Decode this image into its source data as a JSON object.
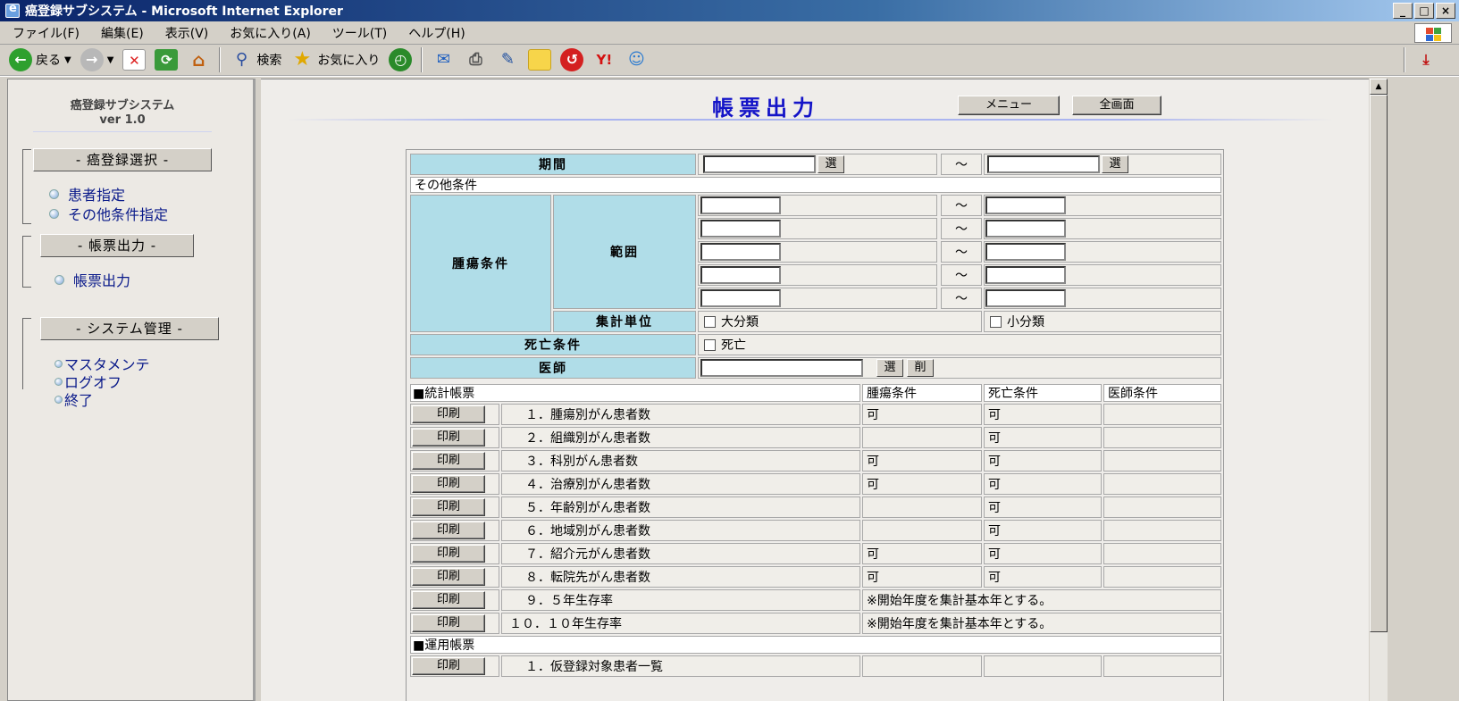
{
  "window": {
    "title": "癌登録サブシステム - Microsoft Internet Explorer",
    "minimize": "_",
    "maximize": "□",
    "close": "×"
  },
  "menubar": [
    "ファイル(F)",
    "編集(E)",
    "表示(V)",
    "お気に入り(A)",
    "ツール(T)",
    "ヘルプ(H)"
  ],
  "toolbar": {
    "back_label": "戻る",
    "search_label": "検索",
    "favorites_label": "お気に入り",
    "icons": [
      "back-icon",
      "forward-icon",
      "stop-icon",
      "refresh-icon",
      "home-icon",
      "search-icon",
      "favorites-icon",
      "history-icon",
      "mail-icon",
      "print-icon",
      "edit-icon",
      "notes-icon",
      "messenger-icon",
      "yahoo-icon",
      "people-icon",
      "acrobat-icon"
    ]
  },
  "sidebar": {
    "logo_line1": "癌登録サブシステム",
    "logo_line2": "ver 1.0",
    "groups": [
      {
        "title": "- 癌登録選択 -",
        "items": [
          "患者指定",
          "その他条件指定"
        ]
      },
      {
        "title": "- 帳票出力 -",
        "items": [
          "帳票出力"
        ]
      },
      {
        "title": "- システム管理 -",
        "items": [
          "マスタメンテ",
          "ログオフ",
          "終了"
        ]
      }
    ]
  },
  "main": {
    "title": "帳票出力",
    "menu_button": "メニュー",
    "fullscreen_button": "全画面",
    "form": {
      "period_label": "期間",
      "select_label": "選",
      "tilde": "～",
      "other_conditions": "その他条件",
      "tumor_condition_label": "腫瘍条件",
      "range_label": "範囲",
      "aggregation_unit_label": "集計単位",
      "major_class": "大分類",
      "minor_class": "小分類",
      "death_condition_label": "死亡条件",
      "death": "死亡",
      "doctor_label": "医師",
      "doctor_select": "選",
      "doctor_delete": "削"
    },
    "stat_reports": {
      "heading": "■統計帳票",
      "columns": [
        "腫瘍条件",
        "死亡条件",
        "医師条件"
      ],
      "print_label": "印刷",
      "rows": [
        {
          "name": "１．腫瘍別がん患者数",
          "tumor": "可",
          "death": "可",
          "doctor": ""
        },
        {
          "name": "２．組織別がん患者数",
          "tumor": "",
          "death": "可",
          "doctor": ""
        },
        {
          "name": "３．科別がん患者数",
          "tumor": "可",
          "death": "可",
          "doctor": ""
        },
        {
          "name": "４．治療別がん患者数",
          "tumor": "可",
          "death": "可",
          "doctor": ""
        },
        {
          "name": "５．年齢別がん患者数",
          "tumor": "",
          "death": "可",
          "doctor": ""
        },
        {
          "name": "６．地域別がん患者数",
          "tumor": "",
          "death": "可",
          "doctor": ""
        },
        {
          "name": "７．紹介元がん患者数",
          "tumor": "可",
          "death": "可",
          "doctor": ""
        },
        {
          "name": "８．転院先がん患者数",
          "tumor": "可",
          "death": "可",
          "doctor": ""
        },
        {
          "name": "９．５年生存率",
          "note": "※開始年度を集計基本年とする。"
        },
        {
          "name": "１０．１０年生存率",
          "note": "※開始年度を集計基本年とする。"
        }
      ]
    },
    "ops_reports": {
      "heading": "■運用帳票",
      "rows": [
        {
          "name": "１．仮登録対象患者一覧"
        }
      ]
    }
  }
}
